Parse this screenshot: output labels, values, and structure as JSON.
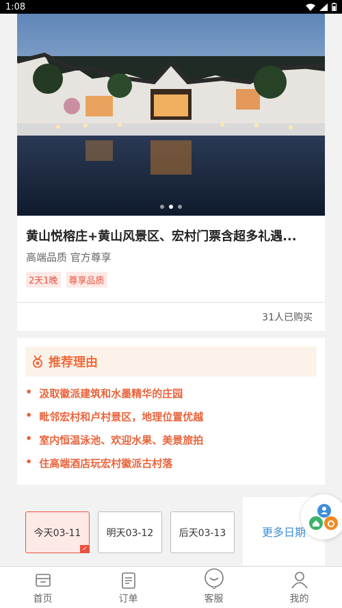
{
  "status_bar": {
    "time": "1:08"
  },
  "carousel": {
    "dot_count": 3,
    "active_index": 1
  },
  "product": {
    "title": "黄山悦榕庄+黄山风景区、宏村门票含超多礼遇...",
    "subtitle": "高端品质 官方尊享",
    "tags": [
      "2天1晚",
      "尊享品质"
    ],
    "sold": "31人已购买"
  },
  "reasons": {
    "title": "推荐理由",
    "items": [
      "汲取徽派建筑和水墨精华的庄园",
      "毗邻宏村和卢村景区，地理位置优越",
      "室内恒温泳池、欢迎水果、美景旅拍",
      "住高端酒店玩宏村徽派古村落"
    ]
  },
  "dates": {
    "options": [
      "今天03-11",
      "明天03-12",
      "后天03-13"
    ],
    "selected_index": 0,
    "more": "更多日期"
  },
  "tabbar": {
    "items": [
      "首页",
      "订单",
      "客服",
      "我的"
    ]
  },
  "colors": {
    "accent": "#e8533f",
    "reason": "#ef6a3d",
    "link": "#3f8fd8"
  }
}
